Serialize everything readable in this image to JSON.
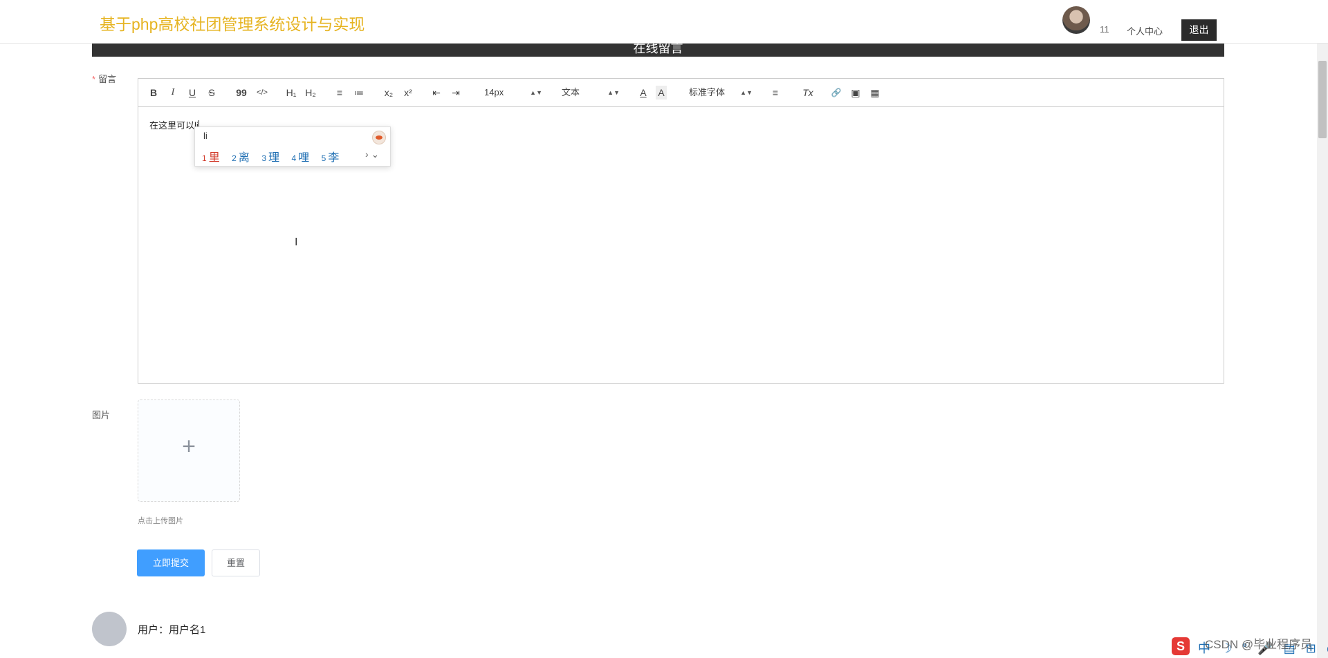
{
  "header": {
    "site_title": "基于php高校社团管理系统设计与实现",
    "user_number": "11",
    "personal_center": "个人中心",
    "logout": "退出"
  },
  "banner": {
    "title": "在线留言"
  },
  "form": {
    "message_label": "留言",
    "required_mark": "*",
    "editor": {
      "toolbar": {
        "bold": "B",
        "italic": "I",
        "underline": "U",
        "strike": "S",
        "quote": "99",
        "code": "</>",
        "h1": "H₁",
        "h2": "H₂",
        "ordered_list": "≡",
        "bullet_list": "≔",
        "subscript": "x₂",
        "superscript": "x²",
        "outdent": "⇤",
        "indent": "⇥",
        "size_select": "14px",
        "type_select": "文本",
        "font_select": "标准字体",
        "font_color": "A",
        "bg_color": "A",
        "align": "≡",
        "clean": "Tx",
        "link": "🔗",
        "image": "▣",
        "video": "▦"
      },
      "content": "在这里可以li"
    },
    "ime": {
      "input": "li",
      "candidates": [
        {
          "num": "1",
          "char": "里"
        },
        {
          "num": "2",
          "char": "离"
        },
        {
          "num": "3",
          "char": "理"
        },
        {
          "num": "4",
          "char": "哩"
        },
        {
          "num": "5",
          "char": "李"
        }
      ],
      "more": "› ⌄"
    },
    "image_label": "图片",
    "upload_plus": "+",
    "upload_tip": "点击上传图片",
    "submit": "立即提交",
    "reset": "重置"
  },
  "comments": [
    {
      "user_label": "用户：用户名1"
    }
  ],
  "watermark": "CSDN @毕业程序员",
  "tray": {
    "icon": "S",
    "status_icons": "中 ☽ ° 🎤 ▤ ⊞ ◷ ☷ ✲"
  },
  "colors": {
    "title": "#e6b422",
    "submit": "#409eff",
    "required": "#f56c6c",
    "logout_bg": "#2b2b2b"
  }
}
